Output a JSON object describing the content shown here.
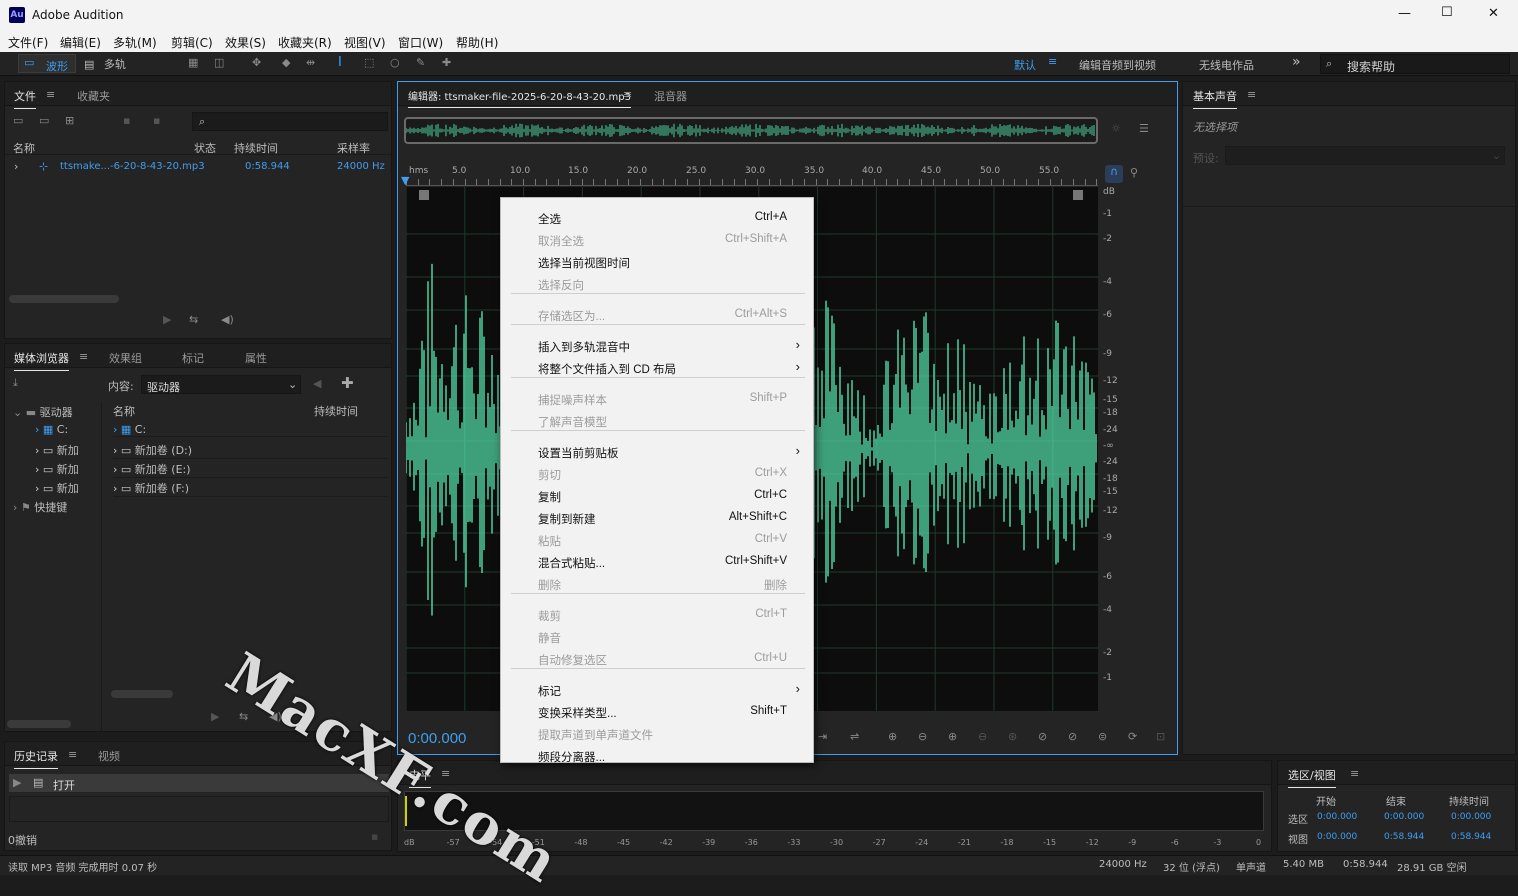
{
  "window": {
    "app_badge": "Au",
    "title": "Adobe Audition",
    "min": "—",
    "max": "☐",
    "close": "✕"
  },
  "menubar": [
    "文件(F)",
    "编辑(E)",
    "多轨(M)",
    "剪辑(C)",
    "效果(S)",
    "收藏夹(R)",
    "视图(V)",
    "窗口(W)",
    "帮助(H)"
  ],
  "toolbar": {
    "waveform": "波形",
    "multitrack": "多轨",
    "workspace": "默认",
    "ws_edit_video": "编辑音频到视频",
    "ws_radio": "无线电作品",
    "more": "»",
    "search_placeholder": "搜索帮助"
  },
  "files_panel": {
    "tab_files": "文件",
    "tab_favorites": "收藏夹",
    "columns": [
      "名称",
      "状态",
      "持续时间",
      "采样率"
    ],
    "file": {
      "name": "ttsmake...-6-20-8-43-20.mp3",
      "duration": "0:58.944",
      "rate": "24000 Hz"
    }
  },
  "media_panel": {
    "tabs": [
      "媒体浏览器",
      "效果组",
      "标记",
      "属性"
    ],
    "content_label": "内容:",
    "content_value": "驱动器",
    "tree": [
      "驱动器",
      "C:",
      "新加",
      "新加",
      "新加",
      "快捷键"
    ],
    "col_name": "名称",
    "col_duration": "持续时间",
    "items": [
      "C:",
      "新加卷 (D:)",
      "新加卷 (E:)",
      "新加卷 (F:)"
    ]
  },
  "history_panel": {
    "tabs": [
      "历史记录",
      "视频"
    ],
    "item": "打开",
    "undo": "0撤销"
  },
  "editor": {
    "tab": "编辑器: ttsmaker-file-2025-6-20-8-43-20.mp3",
    "mixer": "混音器",
    "time": "0:00.000",
    "ticks": [
      "hms",
      "5.0",
      "10.0",
      "15.0",
      "20.0",
      "25.0",
      "30.0",
      "35.0",
      "40.0",
      "45.0",
      "50.0",
      "55.0"
    ],
    "db_labels": [
      "dB",
      "-1",
      "-2",
      "-4",
      "-6",
      "-9",
      "-12",
      "-15",
      "-18",
      "-24",
      "-∞",
      "-24",
      "-18",
      "-15",
      "-12",
      "-9",
      "-6",
      "-4",
      "-2",
      "-1"
    ]
  },
  "basic_sound": {
    "title": "基本声音",
    "no_selection": "无选择项",
    "preset": "预设:"
  },
  "level_panel": {
    "title": "电平",
    "scale": [
      "dB",
      "-57",
      "-54",
      "-51",
      "-48",
      "-45",
      "-42",
      "-39",
      "-36",
      "-33",
      "-30",
      "-27",
      "-24",
      "-21",
      "-18",
      "-15",
      "-12",
      "-9",
      "-6",
      "-3",
      "0"
    ]
  },
  "selection_panel": {
    "title": "选区/视图",
    "col_start": "开始",
    "col_end": "结束",
    "col_dur": "持续时间",
    "row_sel": "选区",
    "row_view": "视图",
    "sel": [
      "0:00.000",
      "0:00.000",
      "0:00.000"
    ],
    "view": [
      "0:00.000",
      "0:58.944",
      "0:58.944"
    ]
  },
  "status": {
    "left": "读取 MP3 音频 完成用时 0.07 秒",
    "rate": "24000 Hz",
    "bits": "32 位 (浮点)",
    "channel": "单声道",
    "size": "5.40 MB",
    "dur": "0:58.944",
    "free": "28.91 GB 空闲"
  },
  "context_menu": [
    {
      "label": "全选",
      "shortcut": "Ctrl+A",
      "disabled": false
    },
    {
      "label": "取消全选",
      "shortcut": "Ctrl+Shift+A",
      "disabled": true
    },
    {
      "label": "选择当前视图时间",
      "shortcut": "",
      "disabled": false
    },
    {
      "label": "选择反向",
      "shortcut": "",
      "disabled": true
    },
    {
      "label": "存储选区为...",
      "shortcut": "Ctrl+Alt+S",
      "disabled": true
    },
    {
      "label": "插入到多轨混音中",
      "shortcut": "",
      "disabled": false,
      "submenu": true
    },
    {
      "label": "将整个文件插入到 CD 布局",
      "shortcut": "",
      "disabled": false,
      "submenu": true
    },
    {
      "label": "捕捉噪声样本",
      "shortcut": "Shift+P",
      "disabled": true
    },
    {
      "label": "了解声音模型",
      "shortcut": "",
      "disabled": true
    },
    {
      "label": "设置当前剪贴板",
      "shortcut": "",
      "disabled": false,
      "submenu": true
    },
    {
      "label": "剪切",
      "shortcut": "Ctrl+X",
      "disabled": true
    },
    {
      "label": "复制",
      "shortcut": "Ctrl+C",
      "disabled": false
    },
    {
      "label": "复制到新建",
      "shortcut": "Alt+Shift+C",
      "disabled": false
    },
    {
      "label": "粘贴",
      "shortcut": "Ctrl+V",
      "disabled": true
    },
    {
      "label": "混合式粘贴...",
      "shortcut": "Ctrl+Shift+V",
      "disabled": false
    },
    {
      "label": "删除",
      "shortcut": "删除",
      "disabled": true
    },
    {
      "label": "裁剪",
      "shortcut": "Ctrl+T",
      "disabled": true
    },
    {
      "label": "静音",
      "shortcut": "",
      "disabled": true
    },
    {
      "label": "自动修复选区",
      "shortcut": "Ctrl+U",
      "disabled": true
    },
    {
      "label": "标记",
      "shortcut": "",
      "disabled": false,
      "submenu": true
    },
    {
      "label": "变换采样类型...",
      "shortcut": "Shift+T",
      "disabled": false
    },
    {
      "label": "提取声道到单声道文件",
      "shortcut": "",
      "disabled": true
    },
    {
      "label": "频段分离器...",
      "shortcut": "",
      "disabled": false
    }
  ],
  "watermark": "MacXF.com",
  "colors": {
    "waveform": "#4fd1a0",
    "accent": "#3f9ef1",
    "bg": "#1c1c1c"
  }
}
